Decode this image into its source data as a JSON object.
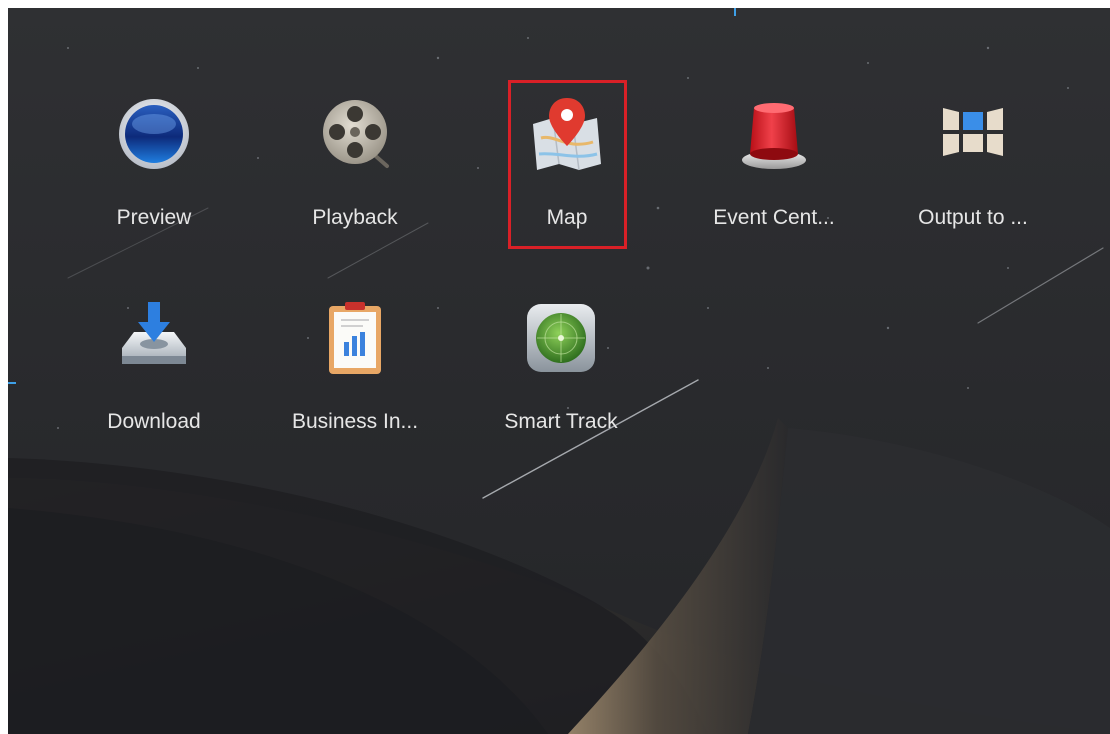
{
  "apps": [
    {
      "label": "Preview",
      "icon": "preview-globe-icon"
    },
    {
      "label": "Playback",
      "icon": "film-reel-icon"
    },
    {
      "label": "Map",
      "icon": "map-pin-icon"
    },
    {
      "label": "Event Cent...",
      "icon": "alarm-light-icon"
    },
    {
      "label": "Output to ...",
      "icon": "video-wall-icon"
    },
    {
      "label": "Download",
      "icon": "download-drive-icon"
    },
    {
      "label": "Business In...",
      "icon": "report-clipboard-icon"
    },
    {
      "label": "Smart Track",
      "icon": "radar-track-icon"
    }
  ],
  "selected_app": "Map",
  "colors": {
    "background": "#2b2c2f",
    "highlight": "#d92027",
    "label": "#e6e6e6",
    "accent": "#3ea0e8"
  }
}
